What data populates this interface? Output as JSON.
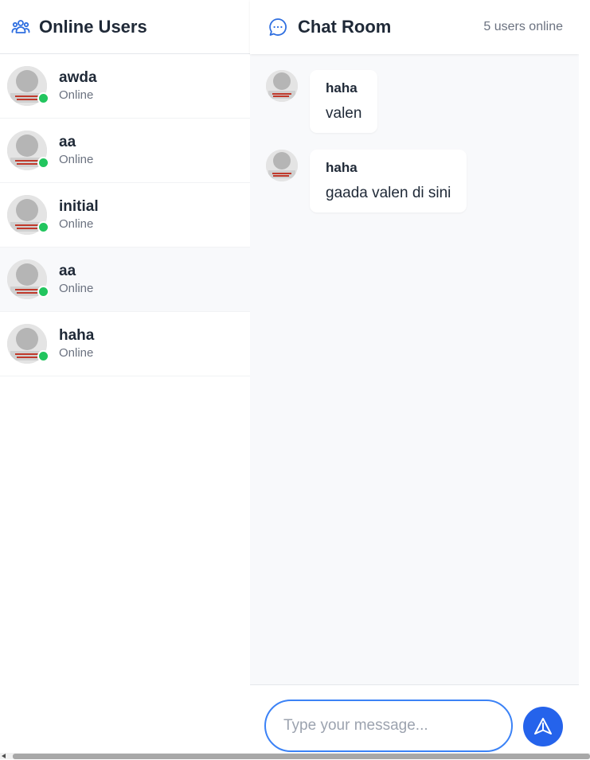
{
  "sidebar": {
    "title": "Online Users",
    "icon": "users-icon",
    "users": [
      {
        "name": "awda",
        "status": "Online"
      },
      {
        "name": "aa",
        "status": "Online"
      },
      {
        "name": "initial",
        "status": "Online"
      },
      {
        "name": "aa",
        "status": "Online"
      },
      {
        "name": "haha",
        "status": "Online"
      }
    ]
  },
  "chat": {
    "title": "Chat Room",
    "icon": "chat-bubble-icon",
    "online_count": "5 users online",
    "messages": [
      {
        "sender": "haha",
        "text": "valen"
      },
      {
        "sender": "haha",
        "text": "gaada valen di sini"
      }
    ],
    "input": {
      "placeholder": "Type your message...",
      "value": ""
    },
    "send_icon": "send-icon"
  },
  "colors": {
    "accent": "#2563eb",
    "online": "#22c55e",
    "chat_bg": "#f8f9fb"
  }
}
